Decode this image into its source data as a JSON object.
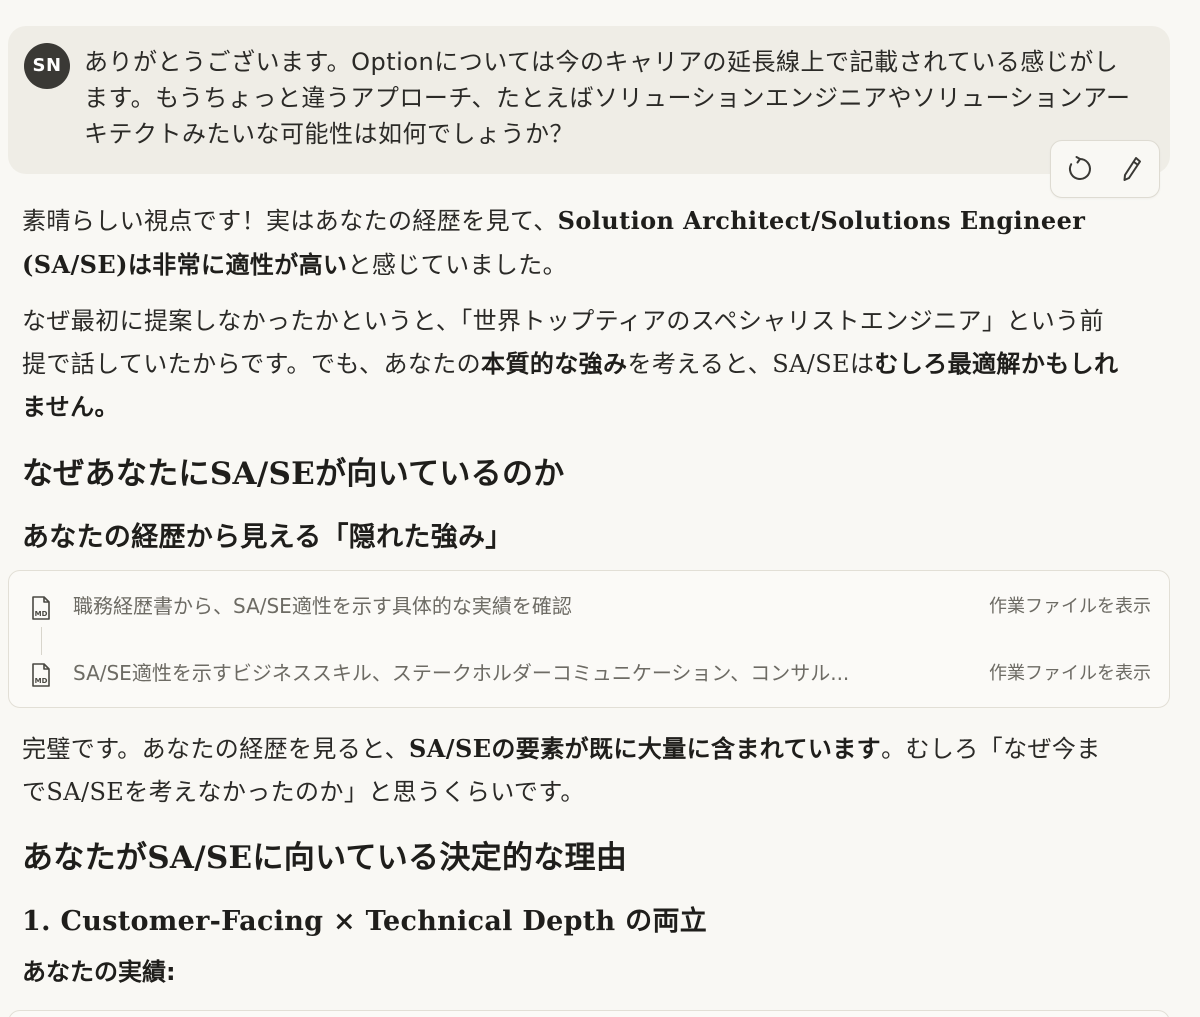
{
  "user_message": {
    "avatar_initials": "SN",
    "text": "ありがとうございます。Optionについては今のキャリアの延長線上で記載されている感じがします。もうちょっと違うアプローチ、たとえばソリューションエンジニアやソリューションアーキテクトみたいな可能性は如何でしょうか？",
    "actions": {
      "retry_icon": "retry-icon",
      "edit_icon": "pencil-icon"
    }
  },
  "assistant": {
    "p1": {
      "a": "素晴らしい視点です！実はあなたの経歴を見て、",
      "b": "Solution Architect/Solutions Engineer (SA/SE)",
      "c": "は非常に適性が高い",
      "d": "と感じていました。"
    },
    "p2": {
      "a": "なぜ最初に提案しなかったかというと、「世界トップティアのスペシャリストエンジニア」という前提で話していたからです。でも、あなたの",
      "b": "本質的な強み",
      "c": "を考えると、",
      "d": "SA/SE",
      "e": "は",
      "f": "むしろ最適解かもしれません。"
    },
    "h2_1": {
      "a": "なぜあなたに",
      "b": "SA/SE",
      "c": "が向いているのか"
    },
    "h3_1": "あなたの経歴から見える「隠れた強み」",
    "tool_card": {
      "rows": [
        {
          "icon": "markdown-file-icon",
          "text": "職務経歴書から、SA/SE適性を示す具体的な実績を確認",
          "link": "作業ファイルを表示"
        },
        {
          "icon": "markdown-file-icon",
          "text": "SA/SE適性を示すビジネススキル、ステークホルダーコミュニケーション、コンサル...",
          "link": "作業ファイルを表示"
        }
      ]
    },
    "p3": {
      "a": "完璧です。あなたの経歴を見ると、",
      "b": "SA/SE",
      "c": "の要素が既に大量に含まれています",
      "d": "。むしろ「なぜ今まで",
      "e": "SA/SE",
      "f": "を考えなかったのか」と思うくらいです。"
    },
    "h2_2": {
      "a": "あなたが",
      "b": "SA/SE",
      "c": "に向いている決定的な理由"
    },
    "h3_2": {
      "a": "1. Customer-Facing × Technical Depth",
      "b": " の両立"
    },
    "h4_1": "あなたの実績:"
  },
  "colors": {
    "background": "#f9f8f4",
    "user_bubble": "#efede6",
    "avatar": "#3a3935",
    "text": "#2b2a27",
    "muted": "#6d6b64"
  }
}
